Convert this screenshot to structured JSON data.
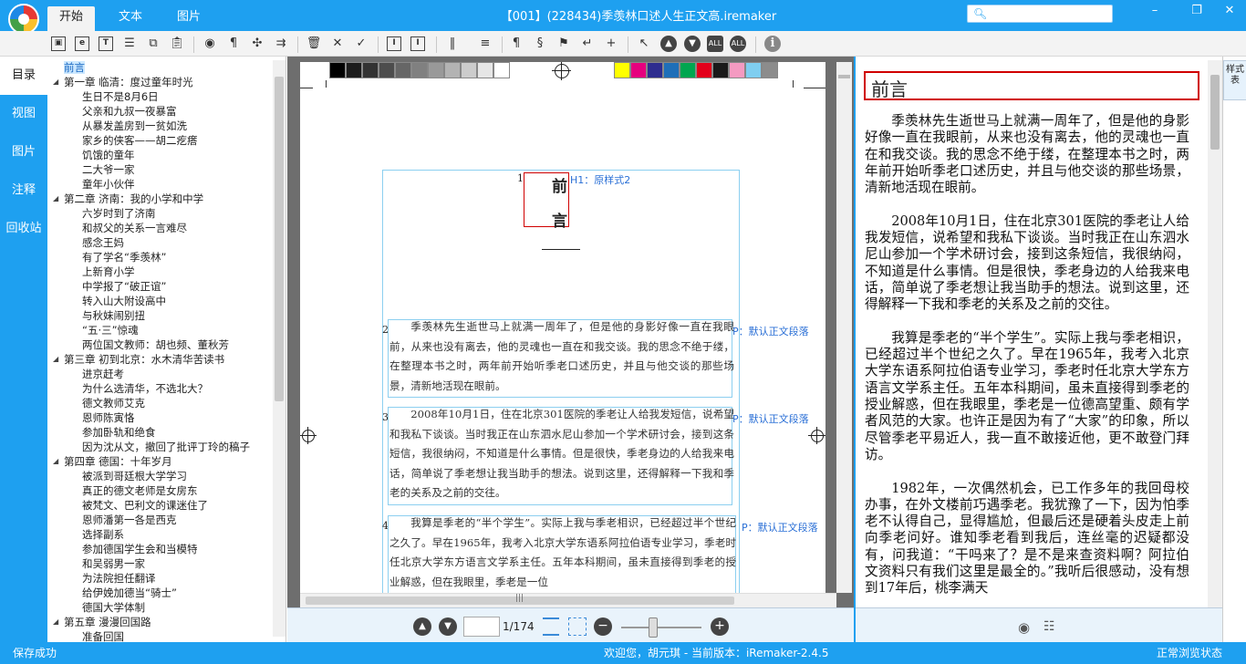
{
  "app": {
    "logo_text": "iRemaker",
    "window_title": "【001】(228434)季羡林口述人生正文高.iremaker",
    "menu_tabs": [
      "开始",
      "文本",
      "图片"
    ],
    "search": {
      "placeholder": ""
    }
  },
  "sidetabs": [
    "目录",
    "视图",
    "图片",
    "注释",
    "回收站"
  ],
  "toc": [
    {
      "text": "前言",
      "level": "top",
      "selected": true
    },
    {
      "text": "第一章 临清：度过童年时光",
      "level": "ch"
    },
    {
      "text": "生日不是8月6日",
      "level": "sub"
    },
    {
      "text": "父亲和九叔一夜暴富",
      "level": "sub"
    },
    {
      "text": "从暴发盖房到一贫如洗",
      "level": "sub"
    },
    {
      "text": "家乡的侠客——胡二疙瘩",
      "level": "sub"
    },
    {
      "text": "饥饿的童年",
      "level": "sub"
    },
    {
      "text": "二大爷一家",
      "level": "sub"
    },
    {
      "text": "童年小伙伴",
      "level": "sub"
    },
    {
      "text": "第二章 济南：我的小学和中学",
      "level": "ch"
    },
    {
      "text": "六岁时到了济南",
      "level": "sub"
    },
    {
      "text": "和叔父的关系一言难尽",
      "level": "sub"
    },
    {
      "text": "感念王妈",
      "level": "sub"
    },
    {
      "text": "有了学名“季羡林”",
      "level": "sub"
    },
    {
      "text": "上新育小学",
      "level": "sub"
    },
    {
      "text": "中学报了“破正谊”",
      "level": "sub"
    },
    {
      "text": "转入山大附设高中",
      "level": "sub"
    },
    {
      "text": "与秋妹闹别扭",
      "level": "sub"
    },
    {
      "text": "“五·三”惊魂",
      "level": "sub"
    },
    {
      "text": "两位国文教师：胡也频、董秋芳",
      "level": "sub"
    },
    {
      "text": "第三章 初到北京：水木清华苦读书",
      "level": "ch"
    },
    {
      "text": "进京赶考",
      "level": "sub"
    },
    {
      "text": "为什么选清华，不选北大？",
      "level": "sub"
    },
    {
      "text": "德文教师艾克",
      "level": "sub"
    },
    {
      "text": "恩师陈寅恪",
      "level": "sub"
    },
    {
      "text": "参加卧轨和绝食",
      "level": "sub"
    },
    {
      "text": "因为沈从文，撤回了批评丁玲的稿子",
      "level": "sub"
    },
    {
      "text": "第四章 德国：十年岁月",
      "level": "ch"
    },
    {
      "text": "被派到哥廷根大学学习",
      "level": "sub"
    },
    {
      "text": "真正的德文老师是女房东",
      "level": "sub"
    },
    {
      "text": "被梵文、巴利文的课迷住了",
      "level": "sub"
    },
    {
      "text": "恩师潘第一各是西克",
      "level": "sub"
    },
    {
      "text": "选择副系",
      "level": "sub"
    },
    {
      "text": "参加德国学生会和当模特",
      "level": "sub"
    },
    {
      "text": "和吴弱男一家",
      "level": "sub"
    },
    {
      "text": "为法院担任翻译",
      "level": "sub"
    },
    {
      "text": "给伊娩加德当“骑士”",
      "level": "sub"
    },
    {
      "text": "德国大学体制",
      "level": "sub"
    },
    {
      "text": "第五章 漫漫回国路",
      "level": "ch"
    },
    {
      "text": "准备回国",
      "level": "sub"
    }
  ],
  "editor": {
    "swatches_gray": [
      "#000000",
      "#1c1c1c",
      "#333333",
      "#4d4d4d",
      "#666666",
      "#808080",
      "#999999",
      "#b3b3b3",
      "#cccccc",
      "#e6e6e6",
      "#ffffff"
    ],
    "swatches_color": [
      "#ffff00",
      "#e6007e",
      "#2e2d8f",
      "#1f6fb8",
      "#00a650",
      "#e3001b",
      "#1a1a1a",
      "#f49ac1",
      "#7fcef0",
      "#8c8c8c"
    ],
    "heading": {
      "num": "1",
      "chars": [
        "前",
        "言"
      ],
      "style": "H1：原样式2"
    },
    "paragraphs": [
      {
        "num": "2",
        "style": "P：默认正文段落",
        "text": "季羡林先生逝世马上就满一周年了，但是他的身影好像一直在我眼前，从来也没有离去，他的灵魂也一直在和我交谈。我的思念不绝于缕，在整理本书之时，两年前开始听季老口述历史，并且与他交谈的那些场景，清新地活现在眼前。"
      },
      {
        "num": "3",
        "style": "P：默认正文段落",
        "text": "2008年10月1日，住在北京301医院的季老让人给我发短信，说希望和我私下谈谈。当时我正在山东泗水尼山参加一个学术研讨会，接到这条短信，我很纳闷，不知道是什么事情。但是很快，季老身边的人给我来电话，简单说了季老想让我当助手的想法。说到这里，还得解释一下我和季老的关系及之前的交往。"
      },
      {
        "num": "4",
        "style": "P：默认正文段落",
        "text": "我算是季老的“半个学生”。实际上我与季老相识，已经超过半个世纪之久了。早在1965年，我考入北京大学东语系阿拉伯语专业学习，季老时任北京大学东方语言文学系主任。五年本科期间，虽未直接得到季老的授业解惑，但在我眼里，季老是一位"
      }
    ],
    "page_total": "1/174",
    "zoom_percent": 40
  },
  "preview": {
    "title": "前言",
    "paragraphs": [
      "季羡林先生逝世马上就满一周年了，但是他的身影好像一直在我眼前，从来也没有离去，他的灵魂也一直在和我交谈。我的思念不绝于缕，在整理本书之时，两年前开始听季老口述历史，并且与他交谈的那些场景，清新地活现在眼前。",
      "2008年10月1日，住在北京301医院的季老让人给我发短信，说希望和我私下谈谈。当时我正在山东泗水尼山参加一个学术研讨会，接到这条短信，我很纳闷，不知道是什么事情。但是很快，季老身边的人给我来电话，简单说了季老想让我当助手的想法。说到这里，还得解释一下我和季老的关系及之前的交往。",
      "我算是季老的“半个学生”。实际上我与季老相识，已经超过半个世纪之久了。早在1965年，我考入北京大学东语系阿拉伯语专业学习，季老时任北京大学东方语言文学系主任。五年本科期间，虽未直接得到季老的授业解惑，但在我眼里，季老是一位德高望重、颇有学者风范的大家。也许正是因为有了“大家”的印象，所以尽管季老平易近人，我一直不敢接近他，更不敢登门拜访。",
      "1982年，一次偶然机会，已工作多年的我回母校办事，在外文楼前巧遇季老。我犹豫了一下，因为怕季老不认得自己，显得尴尬，但最后还是硬着头皮走上前向季老问好。谁知季老看到我后，连丝毫的迟疑都没有，问我道：“干吗来了？是不是来查资料啊？阿拉伯文资料只有我们这里是最全的。”我听后很感动，没有想到17年后，桃李满天"
    ],
    "style_library_label": "样式表"
  },
  "status": {
    "left": "保存成功",
    "center": "欢迎您，胡元琪 - 当前版本：iRemaker-2.4.5",
    "right": "正常浏览状态"
  },
  "colors": {
    "accent": "#1ea0f0",
    "highlight": "#d00000",
    "style_label": "#2a6fd6"
  }
}
